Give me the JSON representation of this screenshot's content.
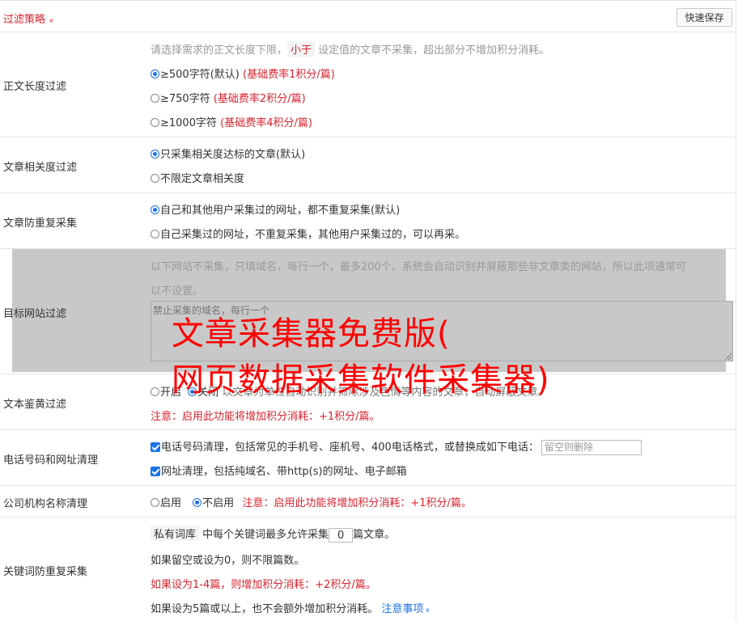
{
  "header": {
    "title": "过滤策略",
    "chevron": "»",
    "save_label": "快速保存"
  },
  "length_filter": {
    "label": "正文长度过滤",
    "desc_pre": "请选择需求的正文长度下限，",
    "desc_tag": "小于",
    "desc_post": "设定值的文章不采集，超出部分不增加积分消耗。",
    "options": [
      {
        "text": "≥500字符(默认)",
        "note": "(基础费率1积分/篇)",
        "selected": true
      },
      {
        "text": "≥750字符",
        "note": "(基础费率2积分/篇)",
        "selected": false
      },
      {
        "text": "≥1000字符",
        "note": "(基础费率4积分/篇)",
        "selected": false
      }
    ]
  },
  "relevance": {
    "label": "文章相关度过滤",
    "options": [
      {
        "text": "只采集相关度达标的文章(默认)",
        "selected": true
      },
      {
        "text": "不限定文章相关度",
        "selected": false
      }
    ]
  },
  "dedup": {
    "label": "文章防重复采集",
    "options": [
      {
        "text": "自己和其他用户采集过的网址，都不重复采集(默认)",
        "selected": true
      },
      {
        "text": "自己采集过的网址，不重复采集，其他用户采集过的，可以再采。",
        "selected": false
      }
    ]
  },
  "site_filter": {
    "label": "目标网站过滤",
    "desc_line1": "以下网站不采集，只填域名，每行一个，最多200个。系统会自动识别并屏蔽那些非文章类的网站，所以此项通常可",
    "desc_line2": "以不设置。",
    "placeholder": "禁止采集的域名，每行一个"
  },
  "porn_filter": {
    "label": "文本鉴黄过滤",
    "on_label": "开启",
    "off_label": "关闭",
    "hidden_text": "以文章为单位自动识别并筛除涉及色情等内容的文章，自动屏蔽文章。",
    "note": "注意：启用此功能将增加积分消耗：+1积分/篇。"
  },
  "phone_clean": {
    "label": "电话号码和网址清理",
    "phone_text": "电话号码清理，包括常见的手机号、座机号、400电话格式，或替换成如下电话：",
    "phone_placeholder": "留空则删除",
    "url_text": "网址清理，包括纯域名、带http(s)的网址、电子邮箱"
  },
  "org_clean": {
    "label": "公司机构名称清理",
    "enable": "启用",
    "disable": "不启用",
    "note": "注意：启用此功能将增加积分消耗：+1积分/篇。"
  },
  "keyword_dedup": {
    "label": "关键词防重复采集",
    "lib_tag": "私有词库",
    "line1_mid": "中每个关键词最多允许采集",
    "count": "0",
    "line1_post": "篇文章。",
    "line2": "如果留空或设为0，则不限篇数。",
    "line3": "如果设为1-4篇，则增加积分消耗：+2积分/篇。",
    "line4": "如果设为5篇或以上，也不会额外增加积分消耗。",
    "notice_link": "注意事项",
    "notice_chev": "»"
  },
  "watermark": {
    "line1": "文章采集器免费版(",
    "line2": "网页数据采集软件采集器)"
  },
  "colors": {
    "accent_red": "#d9232e",
    "accent_blue": "#1a73e8",
    "watermark_red": "#ff0000"
  }
}
